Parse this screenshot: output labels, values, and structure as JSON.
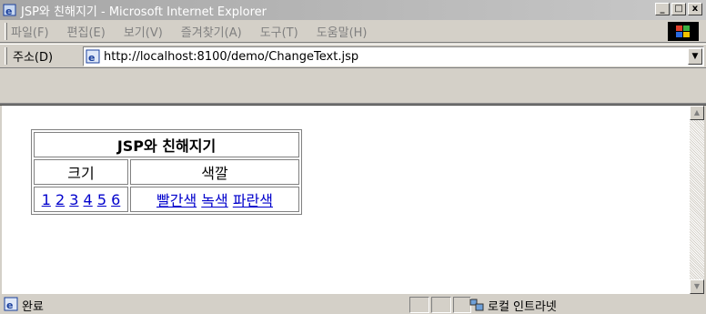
{
  "window": {
    "title": "JSP와 친해지기 - Microsoft Internet Explorer",
    "minimize_symbol": "_",
    "maximize_symbol": "□",
    "close_symbol": "x"
  },
  "menu": {
    "items": [
      {
        "label": "파일(F)"
      },
      {
        "label": "편집(E)"
      },
      {
        "label": "보기(V)"
      },
      {
        "label": "즐겨찾기(A)"
      },
      {
        "label": "도구(T)"
      },
      {
        "label": "도움말(H)"
      }
    ]
  },
  "address": {
    "label": "주소(D)",
    "url": "http://localhost:8100/demo/ChangeText.jsp",
    "dropdown_symbol": "▼"
  },
  "page": {
    "table_title": "JSP와 친해지기",
    "col_size": "크기",
    "col_color": "색깔",
    "size_links": [
      "1",
      "2",
      "3",
      "4",
      "5",
      "6"
    ],
    "color_links": [
      "빨간색",
      "녹색",
      "파란색"
    ]
  },
  "scrollbar": {
    "up_symbol": "▲",
    "down_symbol": "▼"
  },
  "status": {
    "text": "완료",
    "zone": "로컬 인트라넷"
  },
  "colors": {
    "link": "#0000cc",
    "chrome": "#d4d0c8",
    "titlebar": "#a6a6a6"
  }
}
